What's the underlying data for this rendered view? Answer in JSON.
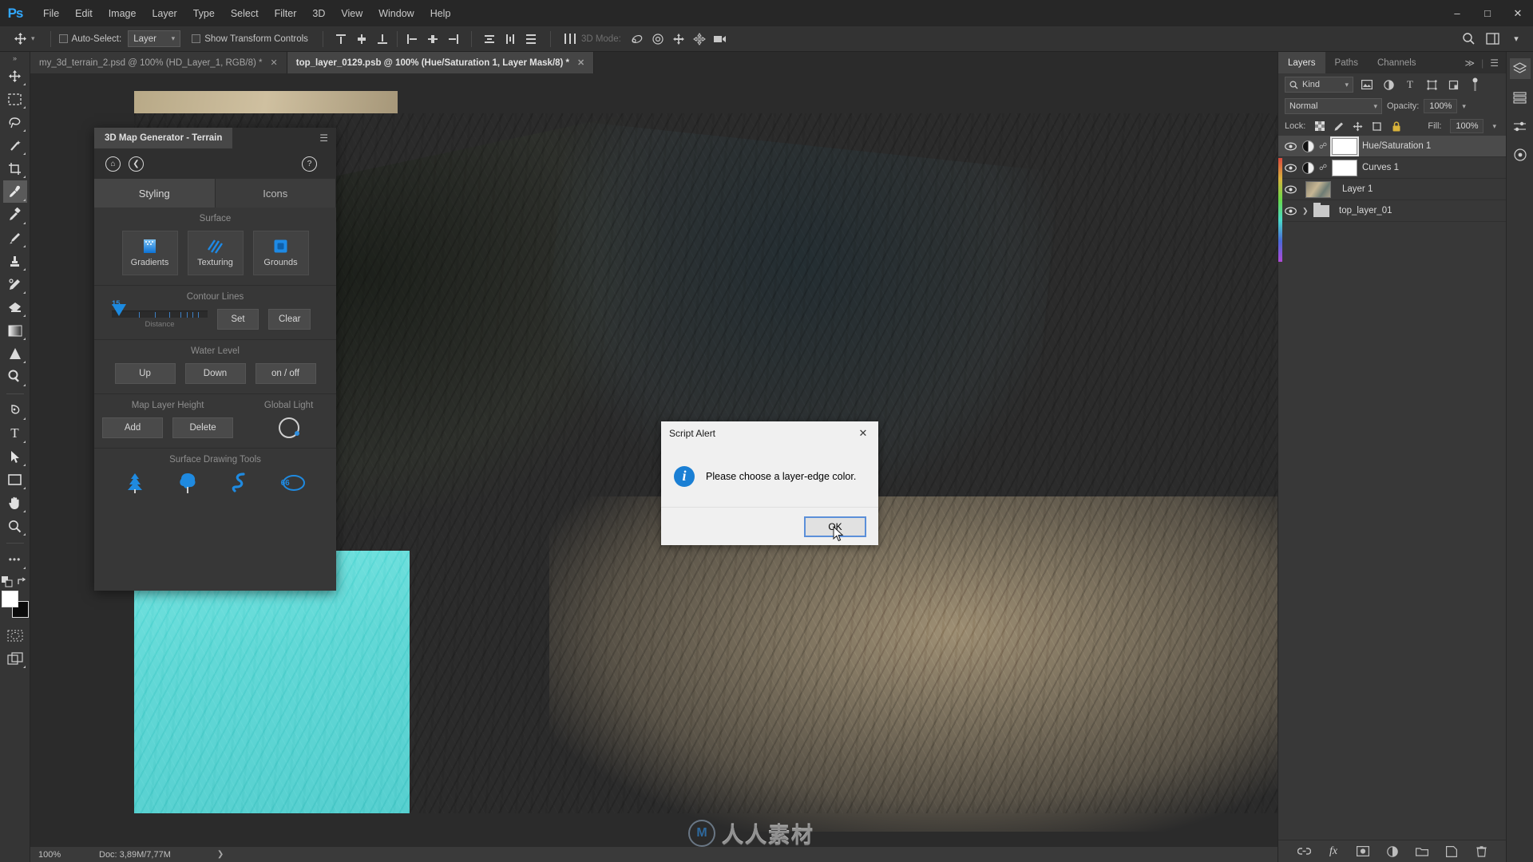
{
  "app": {
    "logo": "Ps",
    "menus": [
      "File",
      "Edit",
      "Image",
      "Layer",
      "Type",
      "Select",
      "Filter",
      "3D",
      "View",
      "Window",
      "Help"
    ],
    "window_controls": {
      "minimize": "–",
      "maximize": "□",
      "close": "✕"
    }
  },
  "options_bar": {
    "tool_icon": "move-tool-icon",
    "auto_select_label": "Auto-Select:",
    "auto_select_value": "Layer",
    "show_transform_label": "Show Transform Controls",
    "threed_mode_label": "3D Mode:",
    "search_icon": "search-icon",
    "workspace_icon": "workspace-icon"
  },
  "tabs": [
    {
      "title": "my_3d_terrain_2.psd @ 100% (HD_Layer_1, RGB/8) *",
      "active": false,
      "close": "✕"
    },
    {
      "title": "top_layer_0129.psb @ 100% (Hue/Saturation 1, Layer Mask/8) *",
      "active": true,
      "close": "✕"
    }
  ],
  "toolbar": {
    "collapse": "»",
    "tools": [
      {
        "name": "move-tool",
        "glyph": "✥",
        "selected": false
      },
      {
        "name": "marquee-tool",
        "glyph": "⬚",
        "selected": false
      },
      {
        "name": "lasso-tool",
        "glyph": "❁",
        "selected": false
      },
      {
        "name": "magic-wand-tool",
        "glyph": "✦",
        "selected": false
      },
      {
        "name": "crop-tool",
        "glyph": "⌗",
        "selected": false
      },
      {
        "name": "eyedropper-tool",
        "glyph": "✐",
        "selected": true
      },
      {
        "name": "healing-brush-tool",
        "glyph": "✐",
        "selected": false
      },
      {
        "name": "brush-tool",
        "glyph": "✎",
        "selected": false
      },
      {
        "name": "clone-stamp-tool",
        "glyph": "⚑",
        "selected": false
      },
      {
        "name": "history-brush-tool",
        "glyph": "✒",
        "selected": false
      },
      {
        "name": "eraser-tool",
        "glyph": "▱",
        "selected": false
      },
      {
        "name": "gradient-tool",
        "glyph": "▦",
        "selected": false
      },
      {
        "name": "blur-tool",
        "glyph": "▲",
        "selected": false
      },
      {
        "name": "dodge-tool",
        "glyph": "⚲",
        "selected": false
      },
      {
        "name": "pen-tool",
        "glyph": "✒",
        "selected": false
      },
      {
        "name": "type-tool",
        "glyph": "T",
        "selected": false
      },
      {
        "name": "path-selection-tool",
        "glyph": "➤",
        "selected": false
      },
      {
        "name": "rectangle-tool",
        "glyph": "▭",
        "selected": false
      },
      {
        "name": "hand-tool",
        "glyph": "✋",
        "selected": false
      },
      {
        "name": "zoom-tool",
        "glyph": "⚲",
        "selected": false
      },
      {
        "name": "edit-toolbar",
        "glyph": "•••",
        "selected": false
      }
    ],
    "foreground_color": "#ffffff",
    "background_color": "#0b0b0b",
    "quickmask_icon": "quick-mask-icon",
    "screenmode_icon": "screen-mode-icon"
  },
  "map_generator": {
    "title": "3D Map Generator - Terrain",
    "menu_icon": "panel-menu-icon",
    "home_icon": "home-icon",
    "back_icon": "back-arrow-icon",
    "help_icon": "help-icon",
    "tabs": [
      {
        "label": "Styling",
        "active": true
      },
      {
        "label": "Icons",
        "active": false
      }
    ],
    "surface": {
      "title": "Surface",
      "buttons": [
        {
          "label": "Gradients",
          "icon": "gradients-icon"
        },
        {
          "label": "Texturing",
          "icon": "texturing-icon"
        },
        {
          "label": "Grounds",
          "icon": "grounds-icon"
        }
      ]
    },
    "contour_lines": {
      "title": "Contour Lines",
      "slider_value": "15",
      "slider_label": "Distance",
      "set_label": "Set",
      "clear_label": "Clear"
    },
    "water_level": {
      "title": "Water Level",
      "buttons": [
        "Up",
        "Down",
        "on / off"
      ]
    },
    "map_layer_height": {
      "title": "Map Layer Height",
      "buttons": [
        "Add",
        "Delete"
      ]
    },
    "global_light": {
      "title": "Global Light",
      "icon": "global-light-icon"
    },
    "surface_drawing_tools": {
      "title": "Surface Drawing Tools",
      "tools": [
        {
          "name": "conifer-tree-icon",
          "label": ""
        },
        {
          "name": "deciduous-tree-icon",
          "label": ""
        },
        {
          "name": "river-path-icon",
          "label": ""
        },
        {
          "name": "number-66-icon",
          "label": "66"
        }
      ]
    }
  },
  "dialog": {
    "title": "Script Alert",
    "close": "✕",
    "icon": "info-icon",
    "icon_glyph": "i",
    "message": "Please choose a layer-edge color.",
    "ok_label": "OK"
  },
  "layers_panel": {
    "tabs": [
      {
        "label": "Layers",
        "active": true
      },
      {
        "label": "Paths",
        "active": false
      },
      {
        "label": "Channels",
        "active": false
      }
    ],
    "expand_icon": "≫",
    "menu_icon": "☰",
    "filter": {
      "search_icon": "search-icon",
      "kind_label": "Kind",
      "caret": "⌄",
      "icons": [
        "pixel-filter-icon",
        "adjustment-filter-icon",
        "type-filter-icon",
        "shape-filter-icon",
        "smart-object-filter-icon"
      ],
      "toggle": "filter-toggle-icon"
    },
    "blend": {
      "mode": "Normal",
      "caret": "⌄",
      "opacity_label": "Opacity:",
      "opacity_value": "100%"
    },
    "lock": {
      "label": "Lock:",
      "icons": [
        "lock-transparent-icon",
        "lock-image-icon",
        "lock-position-icon",
        "lock-artboard-icon",
        "lock-all-icon"
      ],
      "fill_label": "Fill:",
      "fill_value": "100%"
    },
    "layers": [
      {
        "name": "Hue/Saturation 1",
        "type": "adjustment",
        "visible": true,
        "selected": true,
        "linked": true,
        "mask_active": true
      },
      {
        "name": "Curves 1",
        "type": "adjustment",
        "visible": true,
        "selected": false,
        "linked": true,
        "mask_active": false
      },
      {
        "name": "Layer 1",
        "type": "image",
        "visible": true,
        "selected": false,
        "linked": false,
        "mask_active": false
      },
      {
        "name": "top_layer_01",
        "type": "group",
        "visible": true,
        "selected": false,
        "linked": false,
        "mask_active": false
      }
    ],
    "footer_icons": [
      "link-layers-icon",
      "add-layer-style-icon",
      "add-layer-mask-icon",
      "new-adjustment-layer-icon",
      "new-group-icon",
      "new-layer-icon",
      "delete-layer-icon"
    ],
    "footer_fx_label": "fx"
  },
  "right_rail": {
    "icons": [
      "layers-rail-icon",
      "history-rail-icon",
      "adjustments-rail-icon",
      "properties-rail-icon"
    ]
  },
  "status_bar": {
    "zoom": "100%",
    "doc": "Doc: 3,89M/7,77M",
    "arrow": "❯"
  },
  "watermark": {
    "mark": "M",
    "text": "人人素材"
  },
  "colors": {
    "accent_blue": "#1f8ae0",
    "ps_blue": "#31a8ff",
    "panel_bg": "#383838",
    "dialog_bg": "#f0f0f0",
    "water": "#62d8d6"
  }
}
